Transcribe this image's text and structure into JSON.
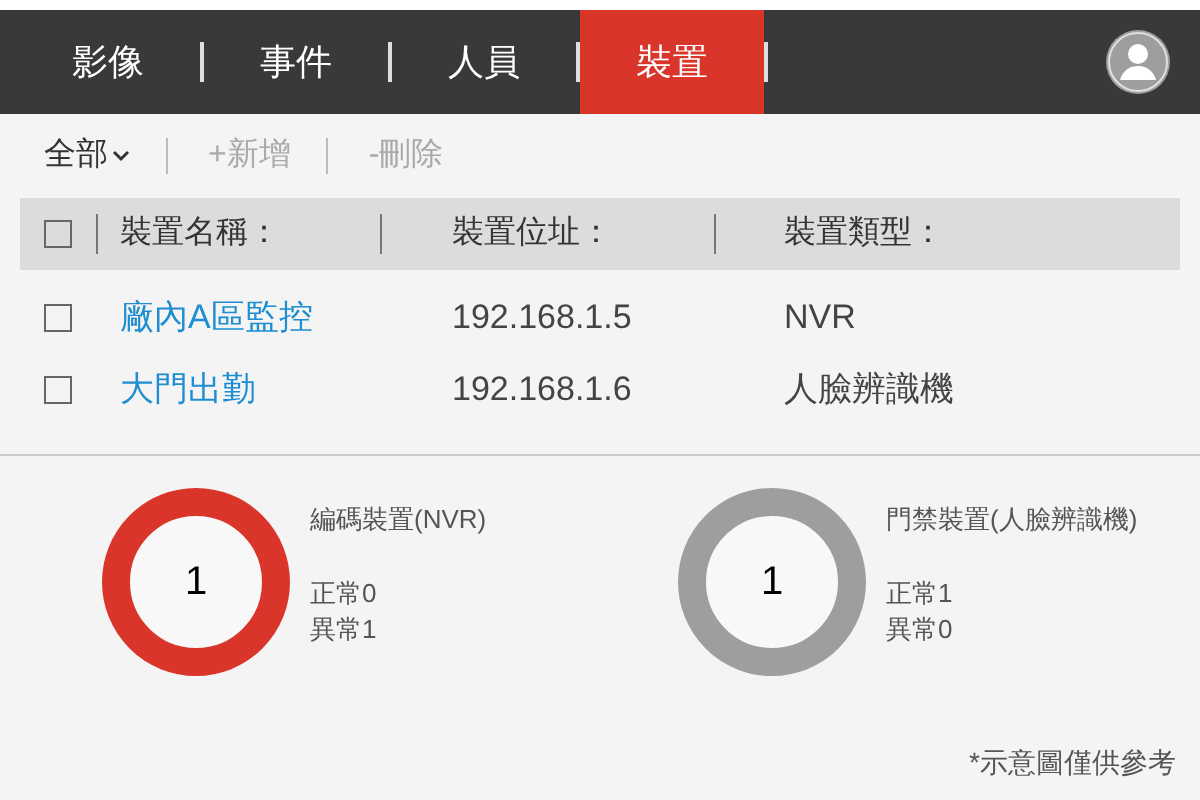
{
  "nav": {
    "tabs": [
      {
        "label": "影像",
        "selected": false
      },
      {
        "label": "事件",
        "selected": false
      },
      {
        "label": "人員",
        "selected": false
      },
      {
        "label": "裝置",
        "selected": true
      }
    ]
  },
  "toolbar": {
    "filter": "全部",
    "actions": [
      {
        "label": "+新增",
        "disabled": true
      },
      {
        "label": "-刪除",
        "disabled": true
      }
    ]
  },
  "table": {
    "header_checked": false,
    "columns": [
      "裝置名稱：",
      "裝置位址：",
      "裝置類型："
    ],
    "rows": [
      {
        "checked": false,
        "name": "廠內A區監控",
        "address": "192.168.1.5",
        "type": "NVR"
      },
      {
        "checked": false,
        "name": "大門出勤",
        "address": "192.168.1.6",
        "type": "人臉辨識機"
      }
    ]
  },
  "summary": [
    {
      "count": "1",
      "color": "#d9352a",
      "title": "編碼裝置(NVR)",
      "normal": "正常0",
      "abnormal": "異常1"
    },
    {
      "count": "1",
      "color": "#9e9e9e",
      "title": "門禁裝置(人臉辨識機)",
      "normal": "正常1",
      "abnormal": "異常0"
    }
  ],
  "footnote": "*示意圖僅供參考"
}
